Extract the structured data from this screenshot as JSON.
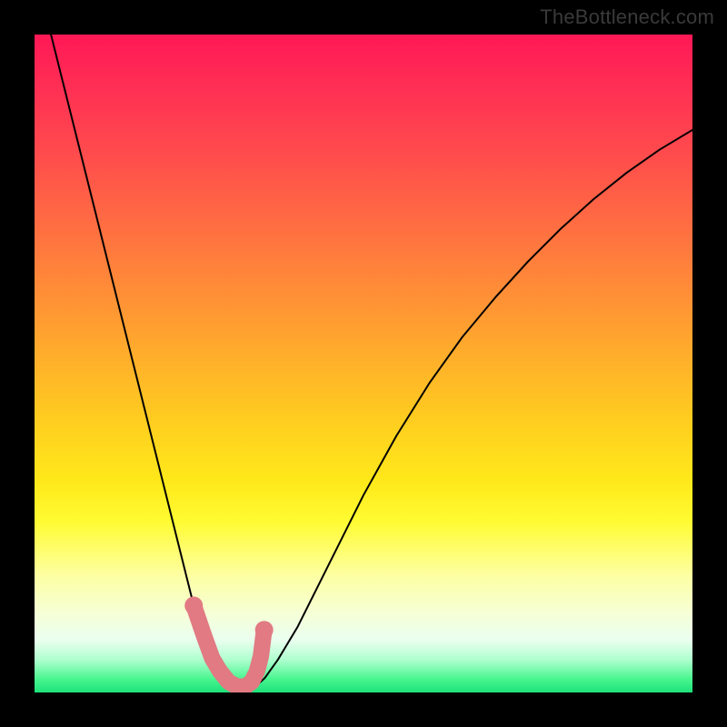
{
  "watermark": "TheBottleneck.com",
  "colors": {
    "curve": "#000000",
    "markers": "#e17a83",
    "frame": "#000000"
  },
  "chart_data": {
    "type": "line",
    "title": "",
    "xlabel": "",
    "ylabel": "",
    "xlim": [
      0,
      100
    ],
    "ylim": [
      0,
      100
    ],
    "series": [
      {
        "name": "bottleneck-curve",
        "x": [
          0,
          3,
          6,
          9,
          12,
          15,
          18,
          21,
          24,
          25,
          26,
          27,
          28,
          29,
          30,
          31,
          32,
          33,
          34,
          35,
          37,
          40,
          45,
          50,
          55,
          60,
          65,
          70,
          75,
          80,
          85,
          90,
          95,
          100
        ],
        "y": [
          110,
          98,
          86,
          74,
          62,
          50,
          38,
          26,
          14,
          11,
          8,
          5.5,
          3.5,
          2,
          1,
          0.5,
          0.5,
          0.8,
          1.3,
          2.2,
          5,
          10,
          20,
          30,
          39,
          47,
          54,
          60,
          65.5,
          70.5,
          75,
          79,
          82.5,
          85.5
        ]
      }
    ],
    "markers": {
      "name": "highlighted-segment",
      "x": [
        24.2,
        25.8,
        27,
        28.2,
        29.5,
        30.8,
        32,
        33,
        33.8,
        34.4,
        34.9
      ],
      "y": [
        13.2,
        8.5,
        5.2,
        3.2,
        1.6,
        0.9,
        0.9,
        1.6,
        3.2,
        5.5,
        9.5
      ]
    }
  }
}
